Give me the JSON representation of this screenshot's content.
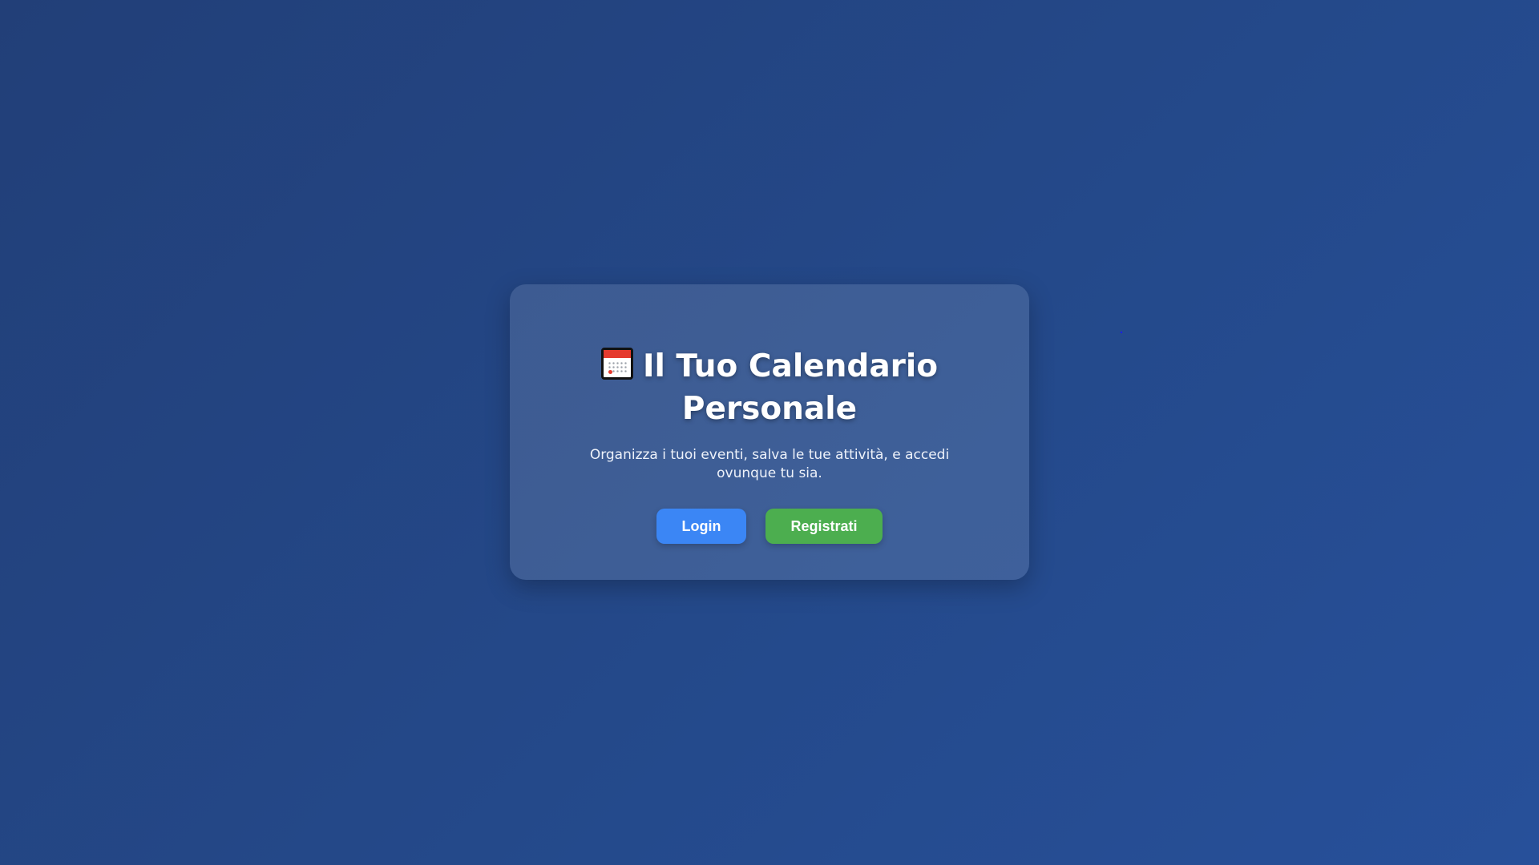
{
  "app": {
    "title_icon": "calendar-icon",
    "title": "Il Tuo Calendario Personale",
    "subtitle": "Organizza i tuoi eventi, salva le tue attività, e accedi ovunque tu sia."
  },
  "actions": {
    "login_label": "Login",
    "register_label": "Registrati"
  },
  "colors": {
    "background": "#24498a",
    "login_button": "#3b86f5",
    "register_button": "#4cae4f"
  }
}
